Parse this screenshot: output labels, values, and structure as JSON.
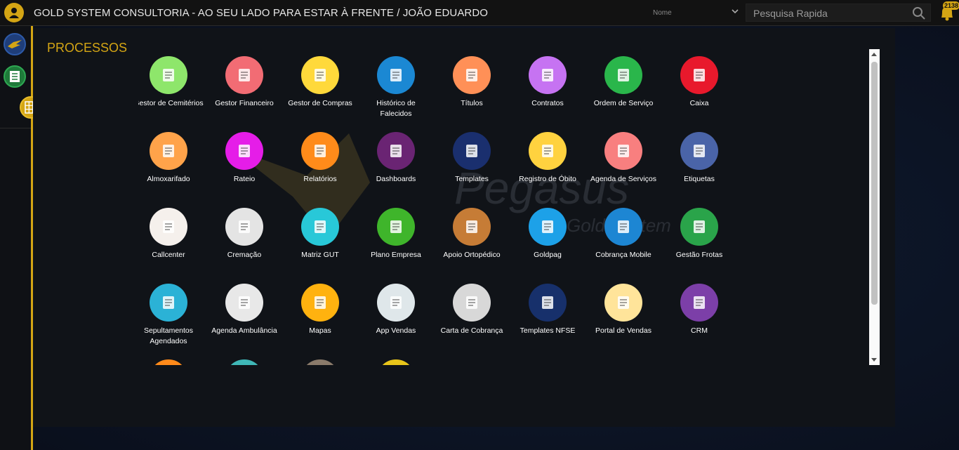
{
  "header": {
    "title": "GOLD SYSTEM CONSULTORIA - AO SEU LADO PARA ESTAR À FRENTE / JOÃO EDUARDO",
    "search_type": "Nome",
    "search_placeholder": "Pesquisa Rapida",
    "notification_count": "2138"
  },
  "panel": {
    "title": "PROCESSOS",
    "watermark_brand": "Pegasus",
    "watermark_sub": "Gold System"
  },
  "modules": [
    {
      "label": "Gestor de Cemitérios",
      "color": "#8ee66b",
      "icon": "tombstone-icon"
    },
    {
      "label": "Gestor Financeiro",
      "color": "#f26c74",
      "icon": "finance-icon"
    },
    {
      "label": "Gestor de Compras",
      "color": "#ffd93b",
      "icon": "basket-icon"
    },
    {
      "label": "Histórico de Falecidos",
      "color": "#1b88d3",
      "icon": "angel-wings-icon"
    },
    {
      "label": "Títulos",
      "color": "#ff9057",
      "icon": "document-icon"
    },
    {
      "label": "Contratos",
      "color": "#c673f2",
      "icon": "contract-icon"
    },
    {
      "label": "Ordem de Serviço",
      "color": "#2ab64b",
      "icon": "clipboard-icon"
    },
    {
      "label": "Caixa",
      "color": "#e8192c",
      "icon": "coins-icon"
    },
    {
      "label": "Almoxarifado",
      "color": "#ffa34a",
      "icon": "box-icon"
    },
    {
      "label": "Rateio",
      "color": "#e51de8",
      "icon": "people-icon"
    },
    {
      "label": "Relatórios",
      "color": "#ff8b1a",
      "icon": "report-icon"
    },
    {
      "label": "Dashboards",
      "color": "#6a2473",
      "icon": "dashboard-icon"
    },
    {
      "label": "Templates",
      "color": "#1a2f6e",
      "icon": "template-icon"
    },
    {
      "label": "Registro de Óbito",
      "color": "#ffd23f",
      "icon": "book-icon"
    },
    {
      "label": "Agenda de Serviços",
      "color": "#f87f7f",
      "icon": "calendar-icon"
    },
    {
      "label": "Etiquetas",
      "color": "#4a64a8",
      "icon": "tags-icon"
    },
    {
      "label": "Callcenter",
      "color": "#f5f0ec",
      "icon": "headset-icon"
    },
    {
      "label": "Cremação",
      "color": "#e4e4e4",
      "icon": "urn-icon"
    },
    {
      "label": "Matriz GUT",
      "color": "#28c8d8",
      "icon": "matrix-icon"
    },
    {
      "label": "Plano Empresa",
      "color": "#3fb52b",
      "icon": "building-icon"
    },
    {
      "label": "Apoio Ortopédico",
      "color": "#c67c36",
      "icon": "wheelchair-icon"
    },
    {
      "label": "Goldpag",
      "color": "#1da1e8",
      "icon": "phone-hand-icon"
    },
    {
      "label": "Cobrança Mobile",
      "color": "#1d86d3",
      "icon": "mobile-money-icon"
    },
    {
      "label": "Gestão Frotas",
      "color": "#2aa44a",
      "icon": "truck-icon"
    },
    {
      "label": "Sepultamentos Agendados",
      "color": "#2bb2d6",
      "icon": "coffin-icon"
    },
    {
      "label": "Agenda Ambulância",
      "color": "#e8e8e8",
      "icon": "ambulance-icon"
    },
    {
      "label": "Mapas",
      "color": "#ffb20f",
      "icon": "map-icon"
    },
    {
      "label": "App Vendas",
      "color": "#dfe7ea",
      "icon": "app-icon"
    },
    {
      "label": "Carta de Cobrança",
      "color": "#d8d8d8",
      "icon": "envelope-icon"
    },
    {
      "label": "Templates NFSE",
      "color": "#17306b",
      "icon": "template-nfse-icon"
    },
    {
      "label": "Portal de Vendas",
      "color": "#ffe49a",
      "icon": "monitor-person-icon"
    },
    {
      "label": "CRM",
      "color": "#7c3fa8",
      "icon": "crm-icon"
    },
    {
      "label": "",
      "color": "#ff8a1a",
      "icon": "partial-icon"
    },
    {
      "label": "",
      "color": "#3fb7b7",
      "icon": "partial-icon"
    },
    {
      "label": "",
      "color": "#8a7a6a",
      "icon": "partial-icon"
    },
    {
      "label": "",
      "color": "#e8c51a",
      "icon": "partial-icon"
    }
  ]
}
